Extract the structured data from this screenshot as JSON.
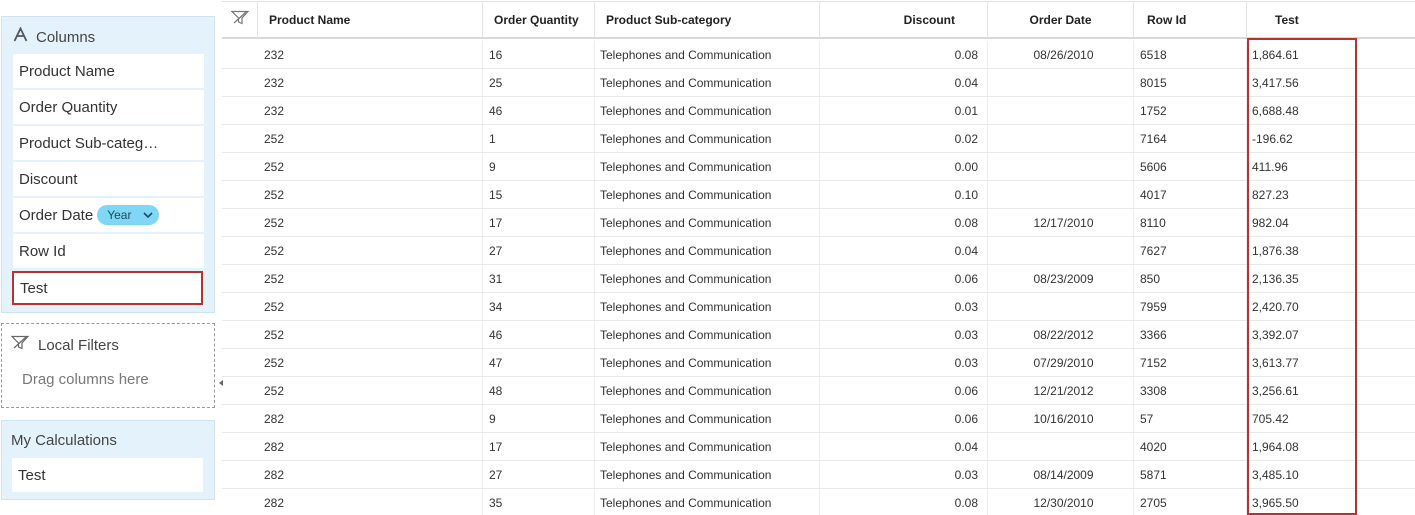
{
  "columns_panel": {
    "title": "Columns",
    "items": [
      {
        "label": "Product Name"
      },
      {
        "label": "Order Quantity"
      },
      {
        "label": "Product Sub-categ…"
      },
      {
        "label": "Discount"
      },
      {
        "label": "Order Date",
        "granularity": "Year"
      },
      {
        "label": "Row Id"
      },
      {
        "label": "Test"
      }
    ]
  },
  "filters_panel": {
    "title": "Local Filters",
    "hint": "Drag columns here"
  },
  "calc_panel": {
    "title": "My Calculations",
    "items": [
      {
        "label": "Test"
      }
    ]
  },
  "grid": {
    "headers": [
      "Product Name",
      "Order Quantity",
      "Product Sub-category",
      "Discount",
      "Order Date",
      "Row Id",
      "Test"
    ],
    "rows": [
      [
        "232",
        "16",
        "Telephones and Communication",
        "0.08",
        "08/26/2010",
        "6518",
        "1,864.61"
      ],
      [
        "232",
        "25",
        "Telephones and Communication",
        "0.04",
        "",
        "8015",
        "3,417.56"
      ],
      [
        "232",
        "46",
        "Telephones and Communication",
        "0.01",
        "",
        "1752",
        "6,688.48"
      ],
      [
        "252",
        "1",
        "Telephones and Communication",
        "0.02",
        "",
        "7164",
        "-196.62"
      ],
      [
        "252",
        "9",
        "Telephones and Communication",
        "0.00",
        "",
        "5606",
        "411.96"
      ],
      [
        "252",
        "15",
        "Telephones and Communication",
        "0.10",
        "",
        "4017",
        "827.23"
      ],
      [
        "252",
        "17",
        "Telephones and Communication",
        "0.08",
        "12/17/2010",
        "8110",
        "982.04"
      ],
      [
        "252",
        "27",
        "Telephones and Communication",
        "0.04",
        "",
        "7627",
        "1,876.38"
      ],
      [
        "252",
        "31",
        "Telephones and Communication",
        "0.06",
        "08/23/2009",
        "850",
        "2,136.35"
      ],
      [
        "252",
        "34",
        "Telephones and Communication",
        "0.03",
        "",
        "7959",
        "2,420.70"
      ],
      [
        "252",
        "46",
        "Telephones and Communication",
        "0.03",
        "08/22/2012",
        "3366",
        "3,392.07"
      ],
      [
        "252",
        "47",
        "Telephones and Communication",
        "0.03",
        "07/29/2010",
        "7152",
        "3,613.77"
      ],
      [
        "252",
        "48",
        "Telephones and Communication",
        "0.06",
        "12/21/2012",
        "3308",
        "3,256.61"
      ],
      [
        "282",
        "9",
        "Telephones and Communication",
        "0.06",
        "10/16/2010",
        "57",
        "705.42"
      ],
      [
        "282",
        "17",
        "Telephones and Communication",
        "0.04",
        "",
        "4020",
        "1,964.08"
      ],
      [
        "282",
        "27",
        "Telephones and Communication",
        "0.03",
        "08/14/2009",
        "5871",
        "3,485.10"
      ],
      [
        "282",
        "35",
        "Telephones and Communication",
        "0.08",
        "12/30/2010",
        "2705",
        "3,965.50"
      ]
    ]
  },
  "colors": {
    "panel_bg": "#e4f3fb",
    "pill_bg": "#7fd6f5",
    "highlight": "#b83232"
  }
}
